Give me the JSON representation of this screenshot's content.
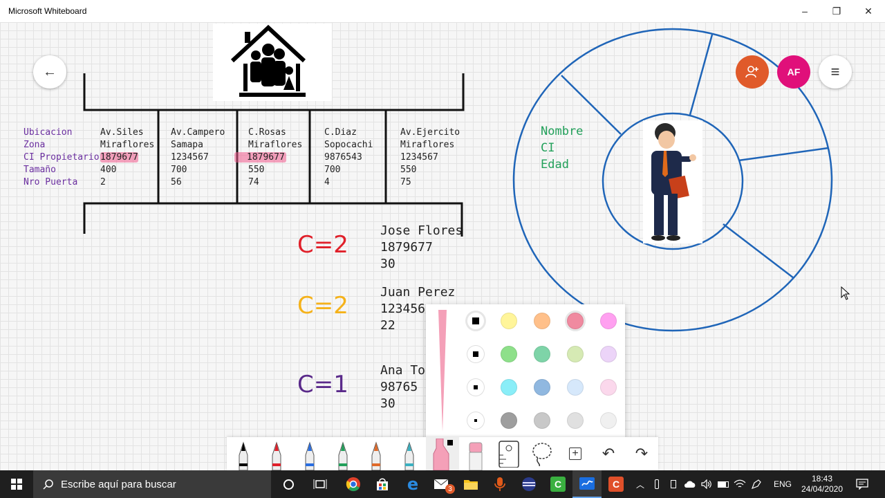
{
  "app": {
    "title": "Microsoft Whiteboard"
  },
  "window_controls": {
    "minimize": "–",
    "restore": "❐",
    "close": "✕"
  },
  "table": {
    "labels": [
      "Ubicacion",
      "Zona",
      "CI Propietario",
      "Tamaño",
      "Nro Puerta"
    ],
    "columns": [
      {
        "ubicacion": "Av.Siles",
        "zona": "Miraflores",
        "ci": "1879677",
        "tamano": "400",
        "puerta": "2",
        "highlight": true
      },
      {
        "ubicacion": "Av.Campero",
        "zona": "Samapa",
        "ci": "1234567",
        "tamano": "700",
        "puerta": "56",
        "highlight": false
      },
      {
        "ubicacion": "C.Rosas",
        "zona": "Miraflores",
        "ci": "1879677",
        "tamano": "550",
        "puerta": "74",
        "highlight": true
      },
      {
        "ubicacion": "C.Diaz",
        "zona": "Sopocachi",
        "ci": "9876543",
        "tamano": "700",
        "puerta": "4",
        "highlight": false
      },
      {
        "ubicacion": "Av.Ejercito",
        "zona": "Miraflores",
        "ci": "1234567",
        "tamano": "550",
        "puerta": "75",
        "highlight": false
      }
    ]
  },
  "counts": [
    {
      "label": "C=2",
      "color": "#e0202a"
    },
    {
      "label": "C=2",
      "color": "#f5b21a"
    },
    {
      "label": "C=1",
      "color": "#5a2a8a"
    }
  ],
  "persons": [
    {
      "name": "Jose Flores",
      "ci": "1879677",
      "age": "30"
    },
    {
      "name": "Juan Perez",
      "ci": "123456",
      "age": "22"
    },
    {
      "name": "Ana Tor",
      "ci": "98765",
      "age": "30"
    }
  ],
  "diagram_labels": [
    "Nombre",
    "CI",
    "Edad"
  ],
  "user_avatar": {
    "initials": "AF",
    "color": "#e0107a"
  },
  "buttons": {
    "back": "←",
    "menu": "≡",
    "invite_color": "#e05a2a"
  },
  "palette": {
    "colors": [
      [
        "#000000",
        "#fff59a",
        "#ffc08a",
        "#f08aa0",
        "#ffa0f0"
      ],
      [
        "#000000",
        "#8ee08a",
        "#7ed4a8",
        "#d6eab4",
        "#ecd4f8"
      ],
      [
        "#000000",
        "#8aeef8",
        "#90b8e0",
        "#d6e8fb",
        "#fbd8ec"
      ],
      [
        "#000000",
        "#9e9e9e",
        "#c8c8c8",
        "#e0e0e0",
        "#f0f0f0"
      ]
    ],
    "selected_color": "#f08aa0",
    "preview_color": "#f4a0b8"
  },
  "toolbar": {
    "pens": [
      "#000000",
      "#e0202a",
      "#2a6ee0",
      "#22a05a",
      "#e06a2a",
      "#3ab0c0"
    ],
    "highlighter_color": "#f4a0b8",
    "eraser_color": "#f4a0b8",
    "undo": "↶",
    "redo": "↷",
    "add": "+"
  },
  "taskbar": {
    "search_placeholder": "Escribe aquí para buscar",
    "mail_badge": "3",
    "language": "ENG",
    "time": "18:43",
    "date": "24/04/2020"
  }
}
